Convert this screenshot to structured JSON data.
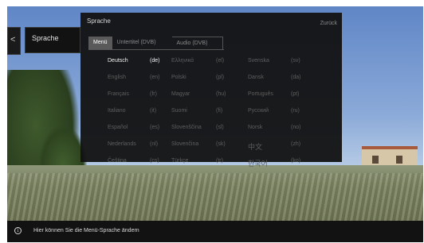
{
  "breadcrumb": {
    "back_glyph": "<",
    "label": "Sprache"
  },
  "dialog": {
    "title": "Sprache",
    "back_label": "Zurück",
    "tabs": [
      {
        "label": "Menü",
        "active": true
      },
      {
        "label": "Untertitel (DVB)",
        "active": false
      },
      {
        "label": "Audio (DVB)",
        "active": false
      }
    ],
    "columns": [
      [
        {
          "name": "Deutsch",
          "code": "(de)",
          "selected": true
        },
        {
          "name": "English",
          "code": "(en)"
        },
        {
          "name": "Français",
          "code": "(fr)"
        },
        {
          "name": "Italiano",
          "code": "(it)"
        },
        {
          "name": "Español",
          "code": "(es)"
        },
        {
          "name": "Nederlands",
          "code": "(nl)"
        },
        {
          "name": "Čeština",
          "code": "(cs)"
        }
      ],
      [
        {
          "name": "Ελληνικά",
          "code": "(el)"
        },
        {
          "name": "Polski",
          "code": "(pl)"
        },
        {
          "name": "Magyar",
          "code": "(hu)"
        },
        {
          "name": "Suomi",
          "code": "(fi)"
        },
        {
          "name": "Slovenščina",
          "code": "(sl)"
        },
        {
          "name": "Slovenčina",
          "code": "(sk)"
        },
        {
          "name": "Türkçe",
          "code": "(tr)"
        }
      ],
      [
        {
          "name": "Svenska",
          "code": "(sv)"
        },
        {
          "name": "Dansk",
          "code": "(da)"
        },
        {
          "name": "Português",
          "code": "(pt)"
        },
        {
          "name": "Русский",
          "code": "(ru)"
        },
        {
          "name": "Norsk",
          "code": "(no)"
        },
        {
          "name": "中文",
          "code": "(zh)"
        },
        {
          "name": "한국어",
          "code": "(ko)"
        }
      ]
    ]
  },
  "infobar": {
    "icon": "info-icon",
    "text": "Hier können Sie die Menü-Sprache ändern"
  },
  "colors": {
    "selected_text": "#f2f2f2",
    "dim_text": "#5e5e5e",
    "panel_bg": "#121212"
  }
}
